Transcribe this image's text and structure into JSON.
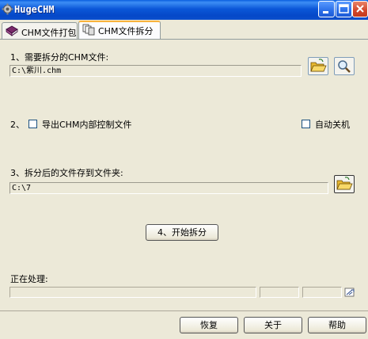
{
  "window": {
    "title": "HugeCHM"
  },
  "tabs": [
    {
      "label": "CHM文件打包",
      "active": false
    },
    {
      "label": "CHM文件拆分",
      "active": true
    }
  ],
  "step1": {
    "label": "1、需要拆分的CHM文件:",
    "value": "C:\\紫川.chm"
  },
  "step2": {
    "label": "2、",
    "export_checkbox_label": "导出CHM内部控制文件",
    "export_checked": false,
    "shutdown_label": "自动关机",
    "shutdown_checked": false
  },
  "step3": {
    "label": "3、拆分后的文件存到文件夹:",
    "value": "C:\\7"
  },
  "step4": {
    "button_label": "4、开始拆分"
  },
  "progress": {
    "label": "正在处理:"
  },
  "footer": {
    "restore_label": "恢复",
    "about_label": "关于",
    "help_label": "帮助"
  },
  "colors": {
    "titlebar": "#0b57d8",
    "face": "#ece9d8",
    "tab_highlight": "#f8b33e"
  }
}
